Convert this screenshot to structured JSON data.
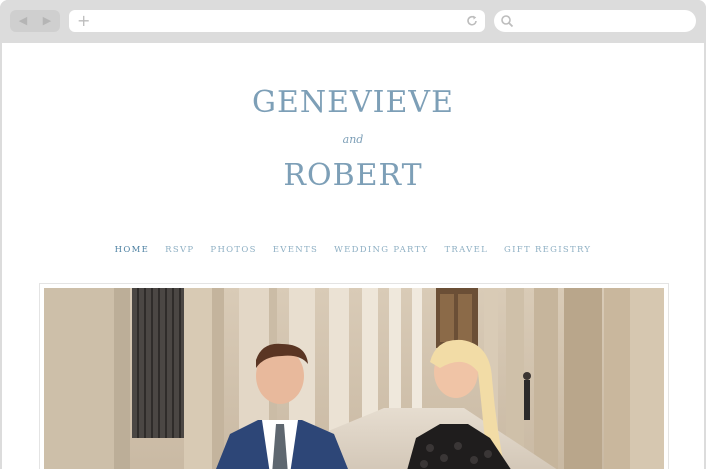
{
  "browser": {
    "back_icon": "back-arrow-icon",
    "forward_icon": "forward-arrow-icon",
    "new_tab_icon": "plus-icon",
    "reload_icon": "reload-icon",
    "search_icon": "search-icon",
    "url_value": "",
    "search_value": ""
  },
  "site": {
    "name_first": "GENEVIEVE",
    "connector": "and",
    "name_second": "ROBERT",
    "text_color": "#7d9fb7"
  },
  "nav": {
    "items": [
      "HOME",
      "RSVP",
      "PHOTOS",
      "EVENTS",
      "WEDDING PARTY",
      "TRAVEL",
      "GIFT REGISTRY"
    ],
    "active": "HOME",
    "active_color": "#4f82a3",
    "color": "#8fb0c4"
  },
  "hero": {
    "description": "engagement-photo"
  }
}
